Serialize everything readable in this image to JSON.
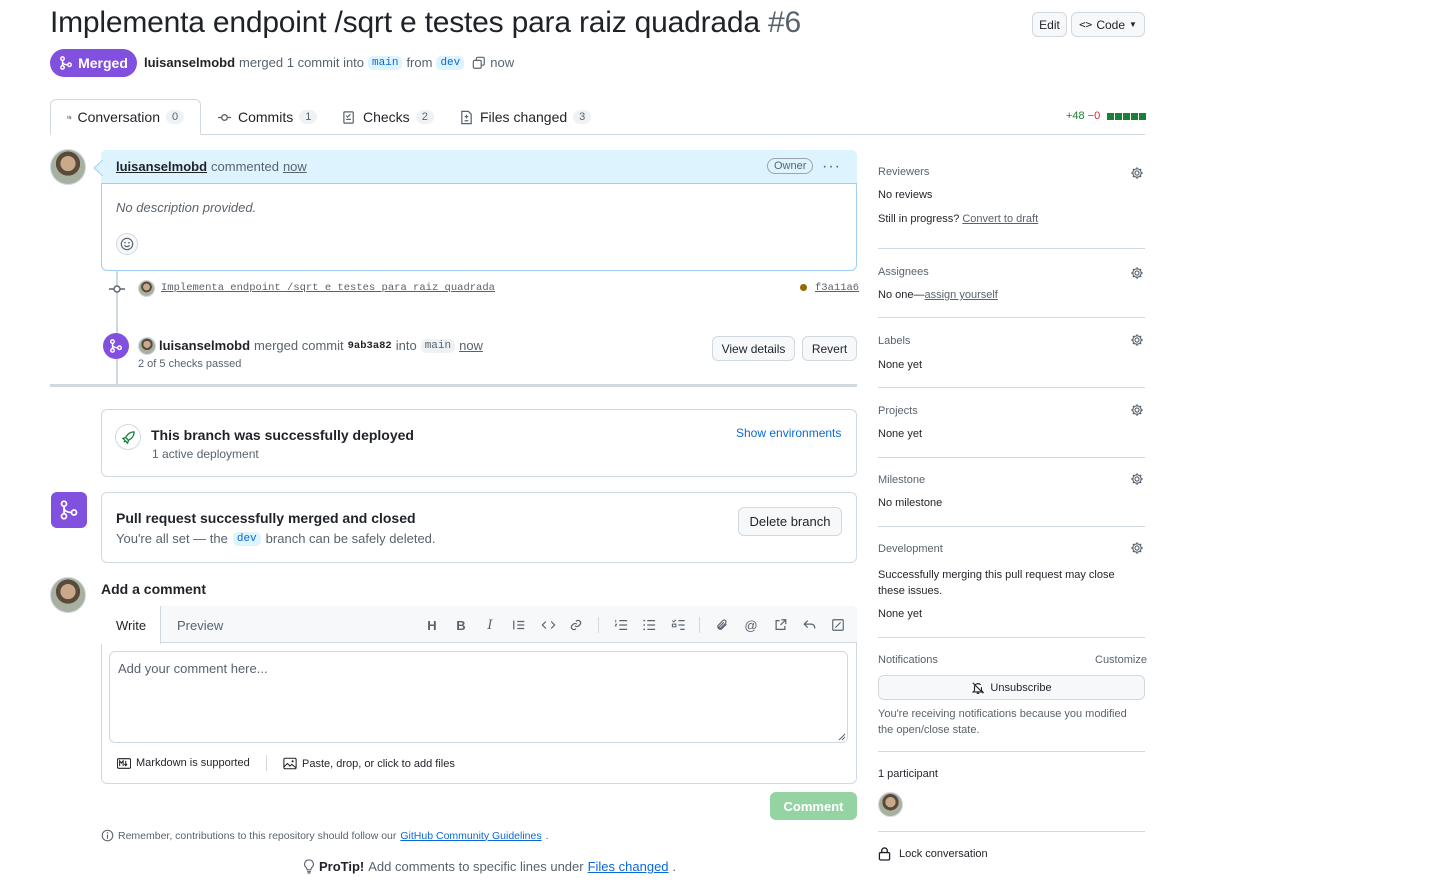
{
  "header": {
    "title": "Implementa endpoint /sqrt e testes para raiz quadrada",
    "number": "#6",
    "edit_label": "Edit",
    "code_label": "Code",
    "state": "Merged",
    "author": "luisanselmobd",
    "merged_text": "merged 1 commit into",
    "base_branch": "main",
    "from_text": "from",
    "head_branch": "dev",
    "time": "now"
  },
  "tabs": [
    {
      "label": "Conversation",
      "count": "0"
    },
    {
      "label": "Commits",
      "count": "1"
    },
    {
      "label": "Checks",
      "count": "2"
    },
    {
      "label": "Files changed",
      "count": "3"
    }
  ],
  "diffstat": {
    "additions": "+48",
    "deletions": "−0"
  },
  "comment": {
    "author": "luisanselmobd",
    "action": "commented",
    "time": "now",
    "role": "Owner",
    "body": "No description provided."
  },
  "commit": {
    "message": "Implementa endpoint /sqrt e testes para raiz quadrada",
    "sha": "f3a11a6"
  },
  "merge_event": {
    "author": "luisanselmobd",
    "action": "merged commit",
    "sha": "9ab3a82",
    "into": "into",
    "branch": "main",
    "time": "now",
    "checks": "2 of 5 checks passed",
    "view_details": "View details",
    "revert": "Revert"
  },
  "deploy": {
    "title": "This branch was successfully deployed",
    "subtitle": "1 active deployment",
    "link": "Show environments"
  },
  "merged_box": {
    "title": "Pull request successfully merged and closed",
    "text_before": "You're all set — the",
    "branch": "dev",
    "text_after": "branch can be safely deleted.",
    "delete_label": "Delete branch"
  },
  "form": {
    "heading": "Add a comment",
    "write_tab": "Write",
    "preview_tab": "Preview",
    "placeholder": "Add your comment here...",
    "markdown_note": "Markdown is supported",
    "attach_note": "Paste, drop, or click to add files",
    "submit": "Comment",
    "guidelines_prefix": "Remember, contributions to this repository should follow our",
    "guidelines_link": "GitHub Community Guidelines",
    "protip_label": "ProTip!",
    "protip_text": "Add comments to specific lines under",
    "protip_link": "Files changed"
  },
  "sidebar": {
    "reviewers": {
      "title": "Reviewers",
      "value": "No reviews",
      "progress": "Still in progress?",
      "draft_link": "Convert to draft"
    },
    "assignees": {
      "title": "Assignees",
      "value": "No one—",
      "link": "assign yourself"
    },
    "labels": {
      "title": "Labels",
      "value": "None yet"
    },
    "projects": {
      "title": "Projects",
      "value": "None yet"
    },
    "milestone": {
      "title": "Milestone",
      "value": "No milestone"
    },
    "development": {
      "title": "Development",
      "text": "Successfully merging this pull request may close these issues.",
      "value": "None yet"
    },
    "notifications": {
      "title": "Notifications",
      "customize": "Customize",
      "button": "Unsubscribe",
      "reason": "You're receiving notifications because you modified the open/close state."
    },
    "participants": {
      "title": "1 participant"
    },
    "lock": "Lock conversation"
  },
  "colors": {
    "merged": "#8250df",
    "link": "#0969da",
    "success": "#1a7f37",
    "comment_btn": "#94d3a2"
  }
}
